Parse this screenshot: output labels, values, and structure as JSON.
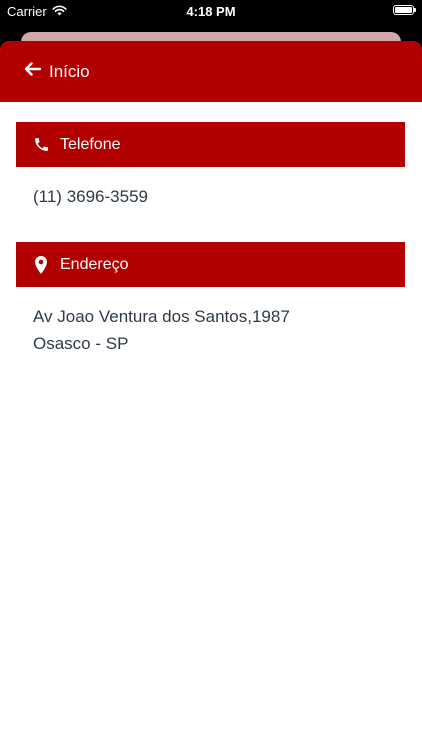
{
  "status_bar": {
    "carrier": "Carrier",
    "time": "4:18 PM",
    "wifi_icon": "wifi-icon",
    "battery_icon": "battery-icon"
  },
  "nav": {
    "back_label": "Início",
    "back_icon": "arrow-left-icon"
  },
  "phone_section": {
    "title": "Telefone",
    "icon": "phone-icon",
    "value": "(11) 3696-3559"
  },
  "address_section": {
    "title": "Endereço",
    "icon": "map-pin-icon",
    "line1": "Av Joao Ventura dos Santos,1987",
    "line2": "Osasco - SP"
  },
  "colors": {
    "accent": "#b20000",
    "text": "#2f3a48",
    "background": "#ffffff"
  }
}
